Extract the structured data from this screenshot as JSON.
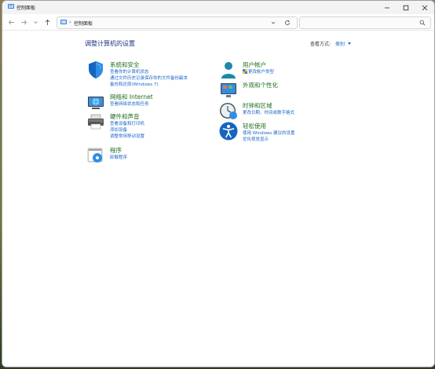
{
  "window": {
    "title": "控制面板"
  },
  "address": {
    "breadcrumb": "控制面板",
    "search_placeholder": ""
  },
  "content": {
    "heading": "调整计算机的设置",
    "view_by_label": "查看方式:",
    "view_by_value": "类别"
  },
  "categories": {
    "system": {
      "title": "系统和安全",
      "links": [
        "查看你的计算机状态",
        "通过文件历史记录保存你的文件备份副本",
        "备份和还原(Windows 7)"
      ]
    },
    "network": {
      "title": "网络和 Internet",
      "links": [
        "查看网络状态和任务"
      ]
    },
    "hardware": {
      "title": "硬件和声音",
      "links": [
        "查看设备和打印机",
        "添加设备",
        "调整常用移动设置"
      ]
    },
    "programs": {
      "title": "程序",
      "links": [
        "卸载程序"
      ]
    },
    "users": {
      "title": "用户帐户",
      "links": [
        "更改帐户类型"
      ]
    },
    "appearance": {
      "title": "外观和个性化",
      "links": []
    },
    "clock": {
      "title": "时钟和区域",
      "links": [
        "更改日期、时间或数字格式"
      ]
    },
    "ease": {
      "title": "轻松使用",
      "links": [
        "使用 Windows 建议的设置",
        "优化视觉显示"
      ]
    }
  },
  "colors": {
    "category_title": "#1e6e1e",
    "link": "#1a66c9",
    "heading": "#1e3287"
  }
}
